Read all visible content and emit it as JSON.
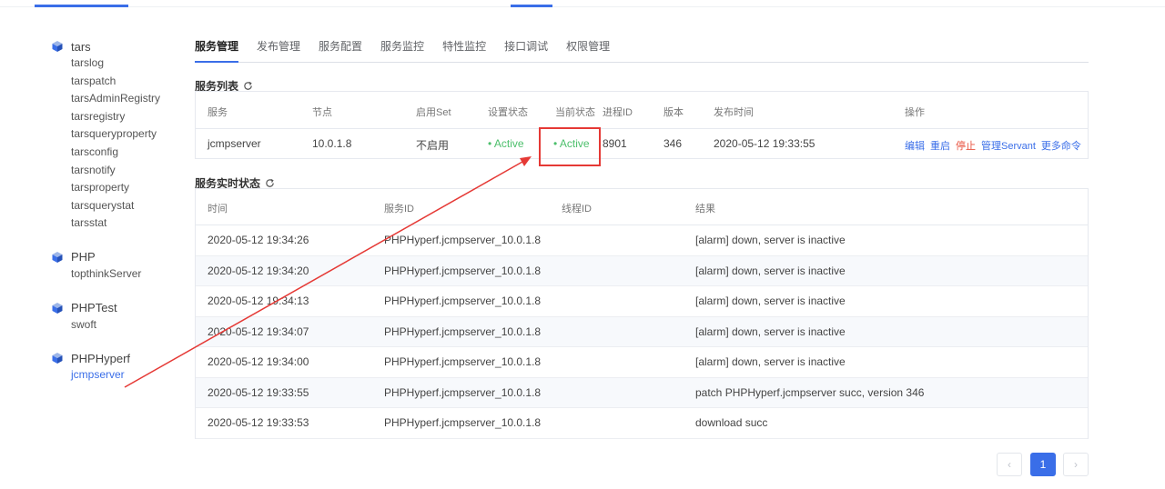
{
  "sidebar": {
    "apps": [
      {
        "name": "tars",
        "servers": [
          "tarslog",
          "tarspatch",
          "tarsAdminRegistry",
          "tarsregistry",
          "tarsqueryproperty",
          "tarsconfig",
          "tarsnotify",
          "tarsproperty",
          "tarsquerystat",
          "tarsstat"
        ]
      },
      {
        "name": "PHP",
        "servers": [
          "topthinkServer"
        ]
      },
      {
        "name": "PHPTest",
        "servers": [
          "swoft"
        ]
      },
      {
        "name": "PHPHyperf",
        "servers": [
          "jcmpserver"
        ]
      }
    ],
    "selected_server": "jcmpserver"
  },
  "tabs": [
    "服务管理",
    "发布管理",
    "服务配置",
    "服务监控",
    "特性监控",
    "接口调试",
    "权限管理"
  ],
  "active_tab": "服务管理",
  "service_list": {
    "title": "服务列表",
    "columns": [
      "服务",
      "节点",
      "启用Set",
      "设置状态",
      "当前状态",
      "进程ID",
      "版本",
      "发布时间",
      "操作"
    ],
    "rows": [
      {
        "service": "jcmpserver",
        "node": "10.0.1.8",
        "set": "不启用",
        "setting_state": "• Active",
        "current_state": "• Active",
        "pid": "8901",
        "version": "346",
        "publish_time": "2020-05-12 19:33:55",
        "ops": [
          "编辑",
          "重启",
          "停止",
          "管理Servant",
          "更多命令"
        ]
      }
    ]
  },
  "realtime_status": {
    "title": "服务实时状态",
    "columns": [
      "时间",
      "服务ID",
      "线程ID",
      "结果"
    ],
    "rows": [
      {
        "time": "2020-05-12 19:34:26",
        "service_id": "PHPHyperf.jcmpserver_10.0.1.8",
        "thread_id": "",
        "result": "[alarm] down, server is inactive"
      },
      {
        "time": "2020-05-12 19:34:20",
        "service_id": "PHPHyperf.jcmpserver_10.0.1.8",
        "thread_id": "",
        "result": "[alarm] down, server is inactive"
      },
      {
        "time": "2020-05-12 19:34:13",
        "service_id": "PHPHyperf.jcmpserver_10.0.1.8",
        "thread_id": "",
        "result": "[alarm] down, server is inactive"
      },
      {
        "time": "2020-05-12 19:34:07",
        "service_id": "PHPHyperf.jcmpserver_10.0.1.8",
        "thread_id": "",
        "result": "[alarm] down, server is inactive"
      },
      {
        "time": "2020-05-12 19:34:00",
        "service_id": "PHPHyperf.jcmpserver_10.0.1.8",
        "thread_id": "",
        "result": "[alarm] down, server is inactive"
      },
      {
        "time": "2020-05-12 19:33:55",
        "service_id": "PHPHyperf.jcmpserver_10.0.1.8",
        "thread_id": "",
        "result": "patch PHPHyperf.jcmpserver succ, version 346"
      },
      {
        "time": "2020-05-12 19:33:53",
        "service_id": "PHPHyperf.jcmpserver_10.0.1.8",
        "thread_id": "",
        "result": "download succ"
      }
    ]
  },
  "pagination": {
    "prev": "‹",
    "current": "1",
    "next": "›"
  },
  "colors": {
    "accent": "#3a6ee8",
    "active_status": "#4cbf6b",
    "danger": "#e8523f",
    "annotation": "#e53935"
  }
}
